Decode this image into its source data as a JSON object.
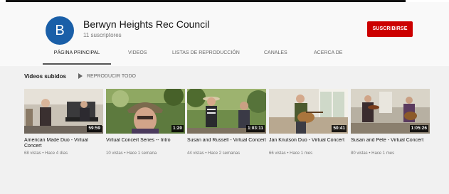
{
  "channel": {
    "avatar_letter": "B",
    "name": "Berwyn Heights Rec Council",
    "subscribers": "11 suscriptores",
    "subscribe_label": "SUSCRIBIRSE"
  },
  "tabs": [
    {
      "label": "PÁGINA PRINCIPAL",
      "active": true
    },
    {
      "label": "VIDEOS",
      "active": false
    },
    {
      "label": "LISTAS DE REPRODUCCIÓN",
      "active": false
    },
    {
      "label": "CANALES",
      "active": false
    },
    {
      "label": "ACERCA DE",
      "active": false
    }
  ],
  "section": {
    "title": "Videos subidos",
    "play_all": "REPRODUCIR TODO"
  },
  "videos": [
    {
      "title": "American Made Duo - Virtual Concert",
      "duration": "59:59",
      "meta": "68 vistas • Hace 4 días"
    },
    {
      "title": "Virtual Concert Series -- Intro",
      "duration": "1:20",
      "meta": "10 vistas • Hace 1 semana"
    },
    {
      "title": "Susan and Russell - Virtual Concert",
      "duration": "1:03:11",
      "meta": "44 vistas • Hace 2 semanas"
    },
    {
      "title": "Jan Knutson Duo - Virtual Concert",
      "duration": "50:41",
      "meta": "66 vistas • Hace 1 mes"
    },
    {
      "title": "Susan and Pete - Virtual Concert",
      "duration": "1:05:26",
      "meta": "80 vistas • Hace 1 mes"
    }
  ]
}
